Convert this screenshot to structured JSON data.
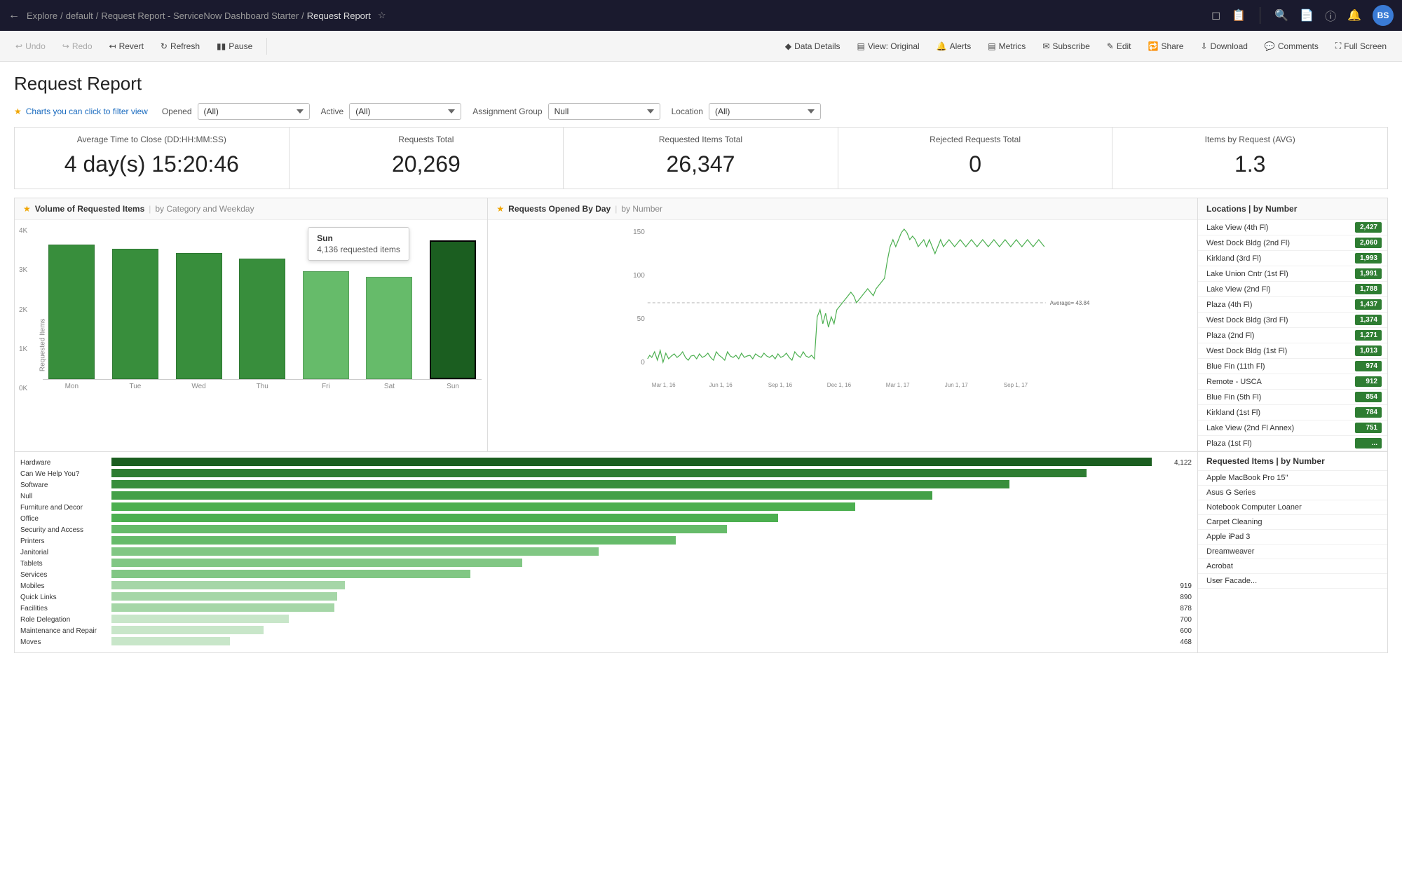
{
  "topNav": {
    "backIcon": "←",
    "breadcrumbs": [
      "Explore",
      "default",
      "Request Report - ServiceNow Dashboard Starter",
      "Request Report"
    ],
    "starIcon": "☆",
    "icons": [
      "mobile-icon",
      "clipboard-icon",
      "search-icon",
      "edit-document-icon",
      "help-icon",
      "bell-icon"
    ],
    "avatar": "BS"
  },
  "toolbar": {
    "undo": "Undo",
    "redo": "Redo",
    "revert": "Revert",
    "refresh": "Refresh",
    "pause": "Pause",
    "dataDetails": "Data Details",
    "viewOriginal": "View: Original",
    "alerts": "Alerts",
    "metrics": "Metrics",
    "subscribe": "Subscribe",
    "edit": "Edit",
    "share": "Share",
    "download": "Download",
    "comments": "Comments",
    "fullScreen": "Full Screen"
  },
  "page": {
    "title": "Request Report"
  },
  "filterHint": "Charts you can click to filter view",
  "filters": [
    {
      "label": "Opened",
      "value": "(All)",
      "options": [
        "(All)"
      ]
    },
    {
      "label": "Active",
      "value": "(All)",
      "options": [
        "(All)"
      ]
    },
    {
      "label": "Assignment Group",
      "value": "Null",
      "options": [
        "Null"
      ]
    },
    {
      "label": "Location",
      "value": "(All)",
      "options": [
        "(All)"
      ]
    }
  ],
  "kpis": [
    {
      "label": "Average Time to Close (DD:HH:MM:SS)",
      "value": "4 day(s) 15:20:46"
    },
    {
      "label": "Requests Total",
      "value": "20,269"
    },
    {
      "label": "Requested Items Total",
      "value": "26,347"
    },
    {
      "label": "Rejected Requests Total",
      "value": "0"
    },
    {
      "label": "Items by Request (AVG)",
      "value": "1.3"
    }
  ],
  "barChart": {
    "title": "Volume of Requested Items",
    "pipe": "|",
    "subtitle": "by Category and Weekday",
    "yAxisTitle": "Requested Items",
    "yLabels": [
      "4K",
      "3K",
      "2K",
      "1K",
      "0K"
    ],
    "bars": [
      {
        "day": "Mon",
        "value": 4000,
        "heightPct": 96,
        "color": "#388e3c"
      },
      {
        "day": "Tue",
        "value": 3900,
        "heightPct": 93,
        "color": "#388e3c"
      },
      {
        "day": "Wed",
        "value": 3750,
        "heightPct": 90,
        "color": "#388e3c"
      },
      {
        "day": "Thu",
        "value": 3600,
        "heightPct": 86,
        "color": "#388e3c"
      },
      {
        "day": "Fri",
        "value": 3200,
        "heightPct": 77,
        "color": "#66bb6a"
      },
      {
        "day": "Sat",
        "value": 3050,
        "heightPct": 73,
        "color": "#66bb6a"
      },
      {
        "day": "Sun",
        "value": 4136,
        "heightPct": 99,
        "color": "#1b5e20"
      }
    ],
    "tooltip": {
      "day": "Sun",
      "value": "4,136 requested items"
    }
  },
  "lineChart": {
    "title": "Requests Opened By Day",
    "pipe": "|",
    "subtitle": "by Number",
    "yLabels": [
      "150",
      "100",
      "50",
      "0"
    ],
    "xLabels": [
      "Mar 1, 16",
      "Jun 1, 16",
      "Sep 1, 16",
      "Dec 1, 16",
      "Mar 1, 17",
      "Jun 1, 17",
      "Sep 1, 17"
    ],
    "avgLabel": "Average= 43.84",
    "color": "#4caf50"
  },
  "locations": {
    "title": "Locations | by Number",
    "items": [
      {
        "name": "Lake View (4th Fl)",
        "value": "2,427"
      },
      {
        "name": "West Dock Bldg (2nd Fl)",
        "value": "2,060"
      },
      {
        "name": "Kirkland (3rd Fl)",
        "value": "1,993"
      },
      {
        "name": "Lake Union Cntr (1st Fl)",
        "value": "1,991"
      },
      {
        "name": "Lake View (2nd Fl)",
        "value": "1,788"
      },
      {
        "name": "Plaza (4th Fl)",
        "value": "1,437"
      },
      {
        "name": "West Dock Bldg (3rd Fl)",
        "value": "1,374"
      },
      {
        "name": "Plaza (2nd Fl)",
        "value": "1,271"
      },
      {
        "name": "West Dock Bldg (1st Fl)",
        "value": "1,013"
      },
      {
        "name": "Blue Fin (11th Fl)",
        "value": "974"
      },
      {
        "name": "Remote - USCA",
        "value": "912"
      },
      {
        "name": "Blue Fin (5th Fl)",
        "value": "854"
      },
      {
        "name": "Kirkland (1st Fl)",
        "value": "784"
      },
      {
        "name": "Lake View (2nd Fl Annex)",
        "value": "751"
      },
      {
        "name": "Plaza (1st Fl)",
        "value": "..."
      }
    ]
  },
  "categoryChart": {
    "maxVal": 4200,
    "rows": [
      {
        "name": "Hardware",
        "value": 4122,
        "color": "#1b5e20"
      },
      {
        "name": "Can We Help You?",
        "value": 3800,
        "color": "#2e7d32"
      },
      {
        "name": "Software",
        "value": 3500,
        "color": "#388e3c"
      },
      {
        "name": "Null",
        "value": 3200,
        "color": "#43a047"
      },
      {
        "name": "Furniture and Decor",
        "value": 2900,
        "color": "#4caf50"
      },
      {
        "name": "Office",
        "value": 2600,
        "color": "#4caf50"
      },
      {
        "name": "Security and Access",
        "value": 2400,
        "color": "#66bb6a"
      },
      {
        "name": "Printers",
        "value": 2200,
        "color": "#66bb6a"
      },
      {
        "name": "Janitorial",
        "value": 1900,
        "color": "#81c784"
      },
      {
        "name": "Tablets",
        "value": 1600,
        "color": "#81c784"
      },
      {
        "name": "Services",
        "value": 1400,
        "color": "#81c784"
      },
      {
        "name": "Mobiles",
        "value": 919,
        "color": "#a5d6a7"
      },
      {
        "name": "Quick Links",
        "value": 890,
        "color": "#a5d6a7"
      },
      {
        "name": "Facilities",
        "value": 878,
        "color": "#a5d6a7"
      },
      {
        "name": "Role Delegation",
        "value": 700,
        "color": "#c8e6c9"
      },
      {
        "name": "Maintenance and Repair",
        "value": 600,
        "color": "#c8e6c9"
      },
      {
        "name": "Moves",
        "value": 468,
        "color": "#c8e6c9"
      }
    ],
    "topValue": 4122
  },
  "requestedItems": {
    "title": "Requested Items | by Number",
    "items": [
      {
        "name": "Apple MacBook Pro 15\""
      },
      {
        "name": "Asus G Series"
      },
      {
        "name": "Notebook Computer Loaner"
      },
      {
        "name": "Carpet Cleaning"
      },
      {
        "name": "Apple iPad 3"
      },
      {
        "name": "Dreamweaver"
      },
      {
        "name": "Acrobat"
      },
      {
        "name": "User Facade..."
      }
    ]
  }
}
